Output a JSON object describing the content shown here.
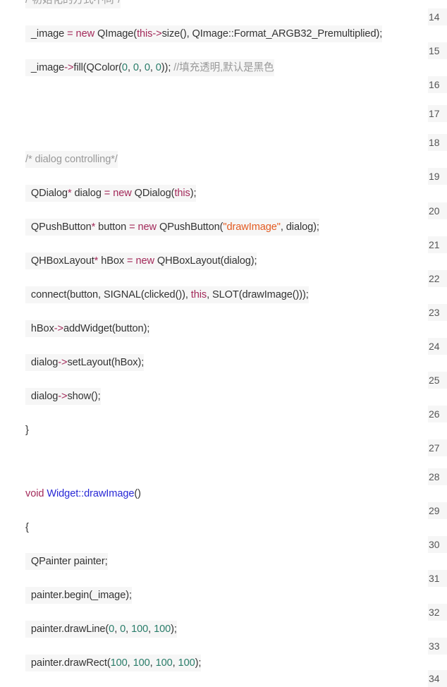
{
  "code_lines": [
    {
      "tokens": [
        {
          "t": "/*初始化的方式不同*/",
          "c": "comment"
        }
      ]
    },
    {
      "tokens": [
        {
          "t": "  _image ",
          "c": "plain"
        },
        {
          "t": "=",
          "c": "keyword"
        },
        {
          "t": " ",
          "c": "plain"
        },
        {
          "t": "new",
          "c": "keyword"
        },
        {
          "t": " QImage(",
          "c": "plain"
        },
        {
          "t": "this",
          "c": "keyword"
        },
        {
          "t": "->",
          "c": "arrow"
        },
        {
          "t": "size(), QImage::Format_ARGB32_Premultiplied);",
          "c": "plain"
        }
      ]
    },
    {
      "tokens": [
        {
          "t": "  _image",
          "c": "plain"
        },
        {
          "t": "->",
          "c": "arrow"
        },
        {
          "t": "fill(QColor(",
          "c": "plain"
        },
        {
          "t": "0",
          "c": "number"
        },
        {
          "t": ", ",
          "c": "plain"
        },
        {
          "t": "0",
          "c": "number"
        },
        {
          "t": ", ",
          "c": "plain"
        },
        {
          "t": "0",
          "c": "number"
        },
        {
          "t": ", ",
          "c": "plain"
        },
        {
          "t": "0",
          "c": "number"
        },
        {
          "t": ")); ",
          "c": "plain"
        },
        {
          "t": "//填充透明,默认是黑色",
          "c": "comment"
        }
      ]
    },
    {
      "tokens": [
        {
          "t": "/* dialog controlling*/",
          "c": "comment"
        }
      ]
    },
    {
      "tokens": [
        {
          "t": "  QDialog",
          "c": "plain"
        },
        {
          "t": "*",
          "c": "keyword"
        },
        {
          "t": " dialog ",
          "c": "plain"
        },
        {
          "t": "=",
          "c": "keyword"
        },
        {
          "t": " ",
          "c": "plain"
        },
        {
          "t": "new",
          "c": "keyword"
        },
        {
          "t": " QDialog(",
          "c": "plain"
        },
        {
          "t": "this",
          "c": "keyword"
        },
        {
          "t": ");",
          "c": "plain"
        }
      ]
    },
    {
      "tokens": [
        {
          "t": "  QPushButton",
          "c": "plain"
        },
        {
          "t": "*",
          "c": "keyword"
        },
        {
          "t": " button ",
          "c": "plain"
        },
        {
          "t": "=",
          "c": "keyword"
        },
        {
          "t": " ",
          "c": "plain"
        },
        {
          "t": "new",
          "c": "keyword"
        },
        {
          "t": " QPushButton(",
          "c": "plain"
        },
        {
          "t": "\"drawImage\"",
          "c": "string"
        },
        {
          "t": ", dialog);",
          "c": "plain"
        }
      ]
    },
    {
      "tokens": [
        {
          "t": "  QHBoxLayout",
          "c": "plain"
        },
        {
          "t": "*",
          "c": "keyword"
        },
        {
          "t": " hBox ",
          "c": "plain"
        },
        {
          "t": "=",
          "c": "keyword"
        },
        {
          "t": " ",
          "c": "plain"
        },
        {
          "t": "new",
          "c": "keyword"
        },
        {
          "t": " QHBoxLayout(dialog);",
          "c": "plain"
        }
      ]
    },
    {
      "tokens": [
        {
          "t": "  connect(button, SIGNAL(clicked()), ",
          "c": "plain"
        },
        {
          "t": "this",
          "c": "keyword"
        },
        {
          "t": ", SLOT(drawImage()));",
          "c": "plain"
        }
      ]
    },
    {
      "tokens": [
        {
          "t": "  hBox",
          "c": "plain"
        },
        {
          "t": "->",
          "c": "arrow"
        },
        {
          "t": "addWidget(button);",
          "c": "plain"
        }
      ]
    },
    {
      "tokens": [
        {
          "t": "  dialog",
          "c": "plain"
        },
        {
          "t": "->",
          "c": "arrow"
        },
        {
          "t": "setLayout(hBox);",
          "c": "plain"
        }
      ]
    },
    {
      "tokens": [
        {
          "t": "  dialog",
          "c": "plain"
        },
        {
          "t": "->",
          "c": "arrow"
        },
        {
          "t": "show();",
          "c": "plain"
        }
      ]
    },
    {
      "tokens": [
        {
          "t": "}",
          "c": "plain"
        }
      ]
    },
    {
      "tokens": [
        {
          "t": "void",
          "c": "keyword"
        },
        {
          "t": " ",
          "c": "plain"
        },
        {
          "t": "Widget::drawImage",
          "c": "func"
        },
        {
          "t": "()",
          "c": "plain"
        }
      ]
    },
    {
      "tokens": [
        {
          "t": "{",
          "c": "plain"
        }
      ]
    },
    {
      "tokens": [
        {
          "t": "  QPainter painter;",
          "c": "plain"
        }
      ]
    },
    {
      "tokens": [
        {
          "t": "  painter.begin(_image);",
          "c": "plain"
        }
      ]
    },
    {
      "tokens": [
        {
          "t": "  painter.drawLine(",
          "c": "plain"
        },
        {
          "t": "0",
          "c": "number"
        },
        {
          "t": ", ",
          "c": "plain"
        },
        {
          "t": "0",
          "c": "number"
        },
        {
          "t": ", ",
          "c": "plain"
        },
        {
          "t": "100",
          "c": "number"
        },
        {
          "t": ", ",
          "c": "plain"
        },
        {
          "t": "100",
          "c": "number"
        },
        {
          "t": ");",
          "c": "plain"
        }
      ]
    },
    {
      "tokens": [
        {
          "t": "  painter.drawRect(",
          "c": "plain"
        },
        {
          "t": "100",
          "c": "number"
        },
        {
          "t": ", ",
          "c": "plain"
        },
        {
          "t": "100",
          "c": "number"
        },
        {
          "t": ", ",
          "c": "plain"
        },
        {
          "t": "100",
          "c": "number"
        },
        {
          "t": ", ",
          "c": "plain"
        },
        {
          "t": "100",
          "c": "number"
        },
        {
          "t": ");",
          "c": "plain"
        }
      ]
    }
  ],
  "line_numbers": [
    "14",
    "15",
    "16",
    "17",
    "18",
    "19",
    "20",
    "21",
    "22",
    "23",
    "24",
    "25",
    "26",
    "27",
    "28",
    "29",
    "30",
    "31",
    "32",
    "33",
    "34"
  ],
  "colors": {
    "keyword": "#a32a5a",
    "string": "#e35a20",
    "number": "#2a7d6a",
    "comment": "#999999",
    "function": "#2828d6",
    "code_background": "#f6f6f6"
  }
}
